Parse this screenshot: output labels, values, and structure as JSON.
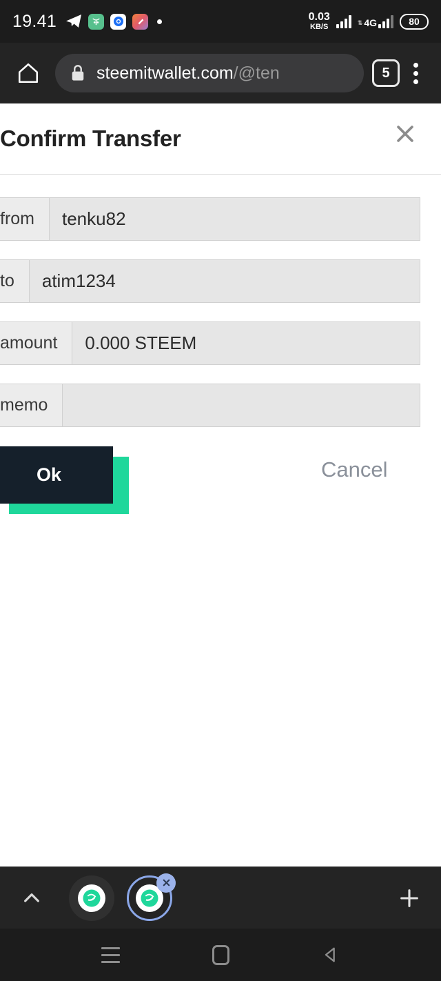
{
  "status_bar": {
    "clock": "19.41",
    "data_rate_value": "0.03",
    "data_rate_unit": "KB/S",
    "network_type": "4G",
    "battery_level": "80",
    "app_icons": [
      "telegram-icon",
      "green-app-icon",
      "blue-circle-app-icon",
      "gradient-app-icon",
      "dot-indicator-icon"
    ]
  },
  "browser": {
    "home_icon": "home-icon",
    "lock_icon": "lock-icon",
    "url_domain": "steemitwallet.com",
    "url_path": "/@ten",
    "tab_count": "5",
    "menu_icon": "overflow-menu-icon"
  },
  "dialog": {
    "title": "Confirm Transfer",
    "close_icon": "close-icon",
    "fields": [
      {
        "label": "from",
        "value": "tenku82"
      },
      {
        "label": "to",
        "value": "atim1234"
      },
      {
        "label": "amount",
        "value": "0.000 STEEM"
      },
      {
        "label": "memo",
        "value": ""
      }
    ],
    "ok_label": "Ok",
    "cancel_label": "Cancel",
    "accent_color": "#1fd79b",
    "ok_bg_color": "#15202b"
  },
  "tab_strip": {
    "collapse_icon": "chevron-up-icon",
    "new_tab_icon": "plus-icon",
    "tabs": [
      {
        "name": "steemit-tab-inactive",
        "active": false
      },
      {
        "name": "steemit-tab-active",
        "active": true,
        "close_icon": "tab-close-icon"
      }
    ]
  },
  "nav_bar": {
    "recents_icon": "recents-icon",
    "home_icon": "home-square-icon",
    "back_icon": "back-triangle-icon"
  }
}
